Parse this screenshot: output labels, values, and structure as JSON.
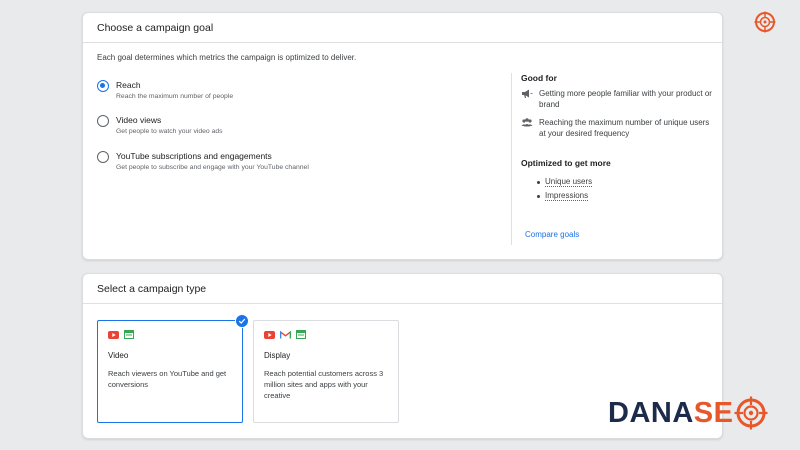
{
  "goal_section": {
    "title": "Choose a campaign goal",
    "description": "Each goal determines which metrics the campaign is optimized to deliver.",
    "options": [
      {
        "label": "Reach",
        "sub": "Reach the maximum number of people",
        "selected": true
      },
      {
        "label": "Video views",
        "sub": "Get people to watch your video ads",
        "selected": false
      },
      {
        "label": "YouTube subscriptions and engagements",
        "sub": "Get people to subscribe and engage with your YouTube channel",
        "selected": false
      }
    ],
    "good_for": {
      "heading": "Good for",
      "items": [
        {
          "icon": "megaphone-icon",
          "text": "Getting more people familiar with your product or brand"
        },
        {
          "icon": "people-icon",
          "text": "Reaching the maximum number of unique users at your desired frequency"
        }
      ]
    },
    "optimized": {
      "heading": "Optimized to get more",
      "metrics": [
        "Unique users",
        "Impressions"
      ]
    },
    "compare_link": "Compare goals"
  },
  "type_section": {
    "title": "Select a campaign type",
    "types": [
      {
        "title": "Video",
        "desc": "Reach viewers on YouTube and get conversions",
        "icons": [
          "youtube-icon",
          "display-icon"
        ],
        "selected": true
      },
      {
        "title": "Display",
        "desc": "Reach potential customers across 3 million sites and apps with your creative",
        "icons": [
          "youtube-icon",
          "gmail-icon",
          "display-icon"
        ],
        "selected": false
      }
    ]
  },
  "watermark": {
    "part1": "DANA",
    "part2": "SE"
  },
  "colors": {
    "accent": "#1a73e8",
    "brand_navy": "#1c2b4a",
    "brand_orange": "#e8572a"
  }
}
